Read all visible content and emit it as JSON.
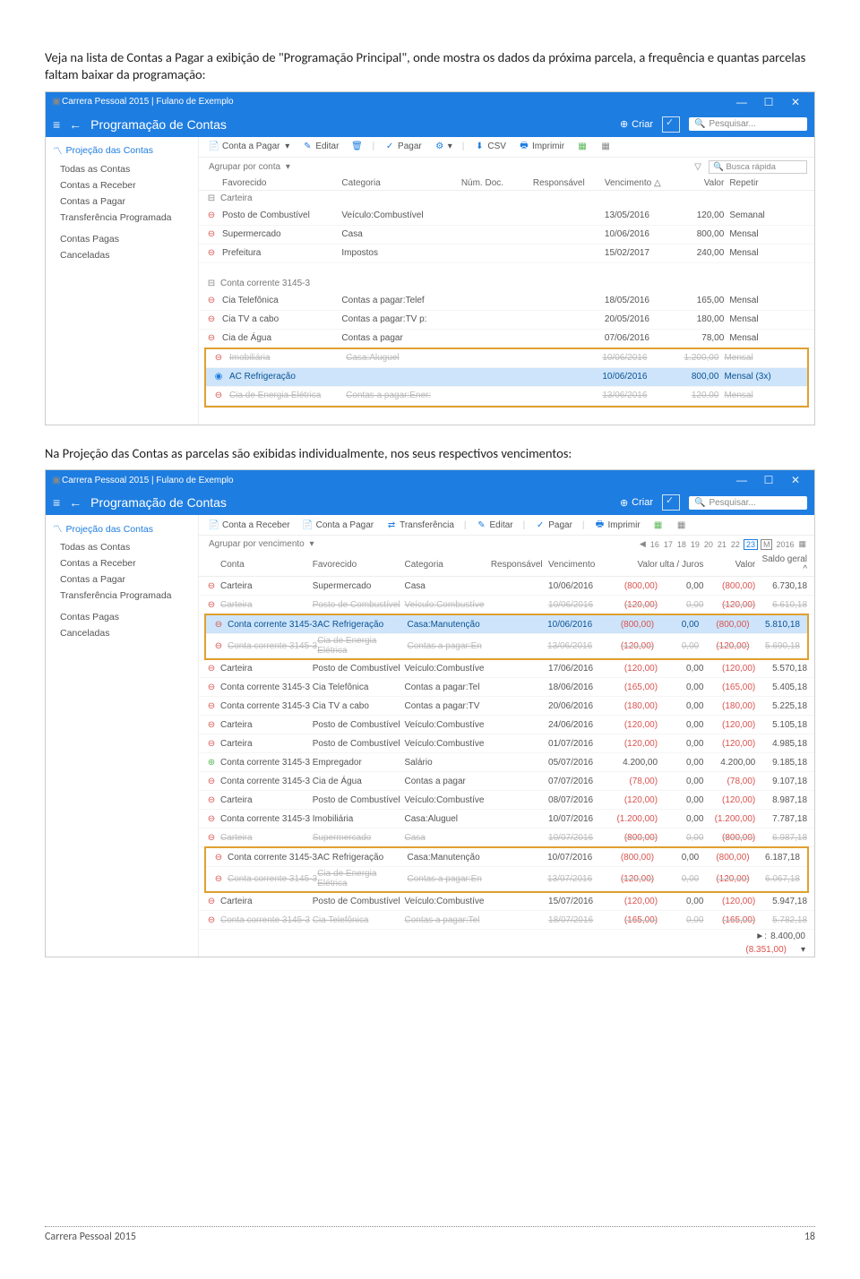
{
  "doc": {
    "p1": "Veja na lista de Contas a Pagar a exibição de \"Programação Principal\", onde mostra os dados da próxima parcela, a frequência e quantas parcelas faltam baixar da programação:",
    "p2": "Na Projeção das Contas as parcelas são exibidas individualmente, nos seus respectivos vencimentos:",
    "footer_left": "Carrera Pessoal 2015",
    "footer_right": "18"
  },
  "s1": {
    "title": "Carrera Pessoal 2015 | Fulano de Exemplo",
    "section": "Programação de Contas",
    "criar": "Criar",
    "search_ph": "Pesquisar...",
    "sidebar_header": "Projeção das Contas",
    "sidebar": [
      "Todas as Contas",
      "Contas a Receber",
      "Contas a Pagar",
      "Transferência Programada",
      "Contas Pagas",
      "Canceladas"
    ],
    "actions": [
      "Conta a Pagar",
      "Editar",
      "Pagar",
      "CSV",
      "Imprimir"
    ],
    "group_label": "Agrupar por conta",
    "quick_ph": "Busca rápida",
    "cols": [
      "Favorecido",
      "Categoria",
      "Núm. Doc.",
      "Responsável",
      "Vencimento",
      "Valor",
      "Repetir"
    ],
    "g1": "Carteira",
    "g1rows": [
      {
        "fav": "Posto de Combustível",
        "cat": "Veículo:Combustível",
        "venc": "13/05/2016",
        "valor": "120,00",
        "rep": "Semanal"
      },
      {
        "fav": "Supermercado",
        "cat": "Casa",
        "venc": "10/06/2016",
        "valor": "800,00",
        "rep": "Mensal"
      },
      {
        "fav": "Prefeitura",
        "cat": "Impostos",
        "venc": "15/02/2017",
        "valor": "240,00",
        "rep": "Mensal"
      }
    ],
    "g2": "Conta corrente 3145-3",
    "g2rows": [
      {
        "fav": "Cia Telefônica",
        "cat": "Contas a pagar:Telef",
        "venc": "18/05/2016",
        "valor": "165,00",
        "rep": "Mensal"
      },
      {
        "fav": "Cia TV a cabo",
        "cat": "Contas a pagar:TV p:",
        "venc": "20/05/2016",
        "valor": "180,00",
        "rep": "Mensal"
      },
      {
        "fav": "Cia de Água",
        "cat": "Contas a pagar",
        "venc": "07/06/2016",
        "valor": "78,00",
        "rep": "Mensal"
      }
    ],
    "g2box": [
      {
        "fav": "Imobiliária",
        "cat": "Casa:Aluguel",
        "venc": "10/06/2016",
        "valor": "1.200,00",
        "rep": "Mensal",
        "strike": true
      },
      {
        "fav": "AC Refrigeração",
        "cat": "",
        "venc": "10/06/2016",
        "valor": "800,00",
        "rep": "Mensal (3x)",
        "sel": true
      },
      {
        "fav": "Cia de Energia Elétrica",
        "cat": "Contas a pagar:Ener:",
        "venc": "13/06/2016",
        "valor": "120,00",
        "rep": "Mensal",
        "strike": true
      }
    ]
  },
  "s2": {
    "title": "Carrera Pessoal 2015 | Fulano de Exemplo",
    "section": "Programação de Contas",
    "criar": "Criar",
    "search_ph": "Pesquisar...",
    "sidebar_header": "Projeção das Contas",
    "sidebar": [
      "Todas as Contas",
      "Contas a Receber",
      "Contas a Pagar",
      "Transferência Programada",
      "Contas Pagas",
      "Canceladas"
    ],
    "actions": [
      "Conta a Receber",
      "Conta a Pagar",
      "Transferência",
      "Editar",
      "Pagar",
      "Imprimir"
    ],
    "group_label": "Agrupar por vencimento",
    "months": [
      "16",
      "17",
      "18",
      "19",
      "20",
      "21",
      "22"
    ],
    "month_cur": "23",
    "month_m": "M",
    "year": "2016",
    "cols": [
      "Conta",
      "Favorecido",
      "Categoria",
      "Responsável",
      "Vencimento",
      "Valor",
      "ulta / Juros",
      "Valor",
      "Saldo geral"
    ],
    "rows": [
      {
        "ic": "-",
        "conta": "Carteira",
        "fav": "Supermercado",
        "cat": "Casa",
        "venc": "10/06/2016",
        "v": "(800,00)",
        "j": "0,00",
        "v2": "(800,00)",
        "s": "6.730,18"
      },
      {
        "ic": "-",
        "conta": "Carteira",
        "fav": "Posto de Combustível",
        "cat": "Veículo:Combustíve",
        "venc": "10/06/2016",
        "v": "(120,00)",
        "j": "0,00",
        "v2": "(120,00)",
        "s": "6.610,18",
        "strike": true
      }
    ],
    "box1": [
      {
        "ic": "-",
        "conta": "Conta corrente 3145-3",
        "fav": "AC Refrigeração",
        "cat": "Casa:Manutenção",
        "venc": "10/06/2016",
        "v": "(800,00)",
        "j": "0,00",
        "v2": "(800,00)",
        "s": "5.810,18",
        "sel": true
      },
      {
        "ic": "-",
        "conta": "Conta corrente 3145-3",
        "fav": "Cia de Energia Elétrica",
        "cat": "Contas a pagar:En",
        "venc": "13/06/2016",
        "v": "(120,00)",
        "j": "0,00",
        "v2": "(120,00)",
        "s": "5.690,18",
        "strike": true
      }
    ],
    "rows2": [
      {
        "ic": "-",
        "conta": "Carteira",
        "fav": "Posto de Combustível",
        "cat": "Veículo:Combustíve",
        "venc": "17/06/2016",
        "v": "(120,00)",
        "j": "0,00",
        "v2": "(120,00)",
        "s": "5.570,18"
      },
      {
        "ic": "-",
        "conta": "Conta corrente 3145-3",
        "fav": "Cia Telefônica",
        "cat": "Contas a pagar:Tel",
        "venc": "18/06/2016",
        "v": "(165,00)",
        "j": "0,00",
        "v2": "(165,00)",
        "s": "5.405,18"
      },
      {
        "ic": "-",
        "conta": "Conta corrente 3145-3",
        "fav": "Cia TV a cabo",
        "cat": "Contas a pagar:TV",
        "venc": "20/06/2016",
        "v": "(180,00)",
        "j": "0,00",
        "v2": "(180,00)",
        "s": "5.225,18"
      },
      {
        "ic": "-",
        "conta": "Carteira",
        "fav": "Posto de Combustível",
        "cat": "Veículo:Combustíve",
        "venc": "24/06/2016",
        "v": "(120,00)",
        "j": "0,00",
        "v2": "(120,00)",
        "s": "5.105,18"
      },
      {
        "ic": "-",
        "conta": "Carteira",
        "fav": "Posto de Combustível",
        "cat": "Veículo:Combustíve",
        "venc": "01/07/2016",
        "v": "(120,00)",
        "j": "0,00",
        "v2": "(120,00)",
        "s": "4.985,18"
      },
      {
        "ic": "+",
        "conta": "Conta corrente 3145-3",
        "fav": "Empregador",
        "cat": "Salário",
        "venc": "05/07/2016",
        "v": "4.200,00",
        "j": "0,00",
        "v2": "4.200,00",
        "s": "9.185,18"
      },
      {
        "ic": "-",
        "conta": "Conta corrente 3145-3",
        "fav": "Cia de Água",
        "cat": "Contas a pagar",
        "venc": "07/07/2016",
        "v": "(78,00)",
        "j": "0,00",
        "v2": "(78,00)",
        "s": "9.107,18"
      },
      {
        "ic": "-",
        "conta": "Carteira",
        "fav": "Posto de Combustível",
        "cat": "Veículo:Combustíve",
        "venc": "08/07/2016",
        "v": "(120,00)",
        "j": "0,00",
        "v2": "(120,00)",
        "s": "8.987,18"
      },
      {
        "ic": "-",
        "conta": "Conta corrente 3145-3",
        "fav": "Imobiliária",
        "cat": "Casa:Aluguel",
        "venc": "10/07/2016",
        "v": "(1.200,00)",
        "j": "0,00",
        "v2": "(1.200,00)",
        "s": "7.787,18"
      },
      {
        "ic": "-",
        "conta": "Carteira",
        "fav": "Supermercado",
        "cat": "Casa",
        "venc": "10/07/2016",
        "v": "(800,00)",
        "j": "0,00",
        "v2": "(800,00)",
        "s": "6.987,18",
        "strike": true
      }
    ],
    "box2": [
      {
        "ic": "-",
        "conta": "Conta corrente 3145-3",
        "fav": "AC Refrigeração",
        "cat": "Casa:Manutenção",
        "venc": "10/07/2016",
        "v": "(800,00)",
        "j": "0,00",
        "v2": "(800,00)",
        "s": "6.187,18"
      },
      {
        "ic": "-",
        "conta": "Conta corrente 3145-3",
        "fav": "Cia de Energia Elétrica",
        "cat": "Contas a pagar:En",
        "venc": "13/07/2016",
        "v": "(120,00)",
        "j": "0,00",
        "v2": "(120,00)",
        "s": "6.067,18",
        "strike": true
      }
    ],
    "rows3": [
      {
        "ic": "-",
        "conta": "Carteira",
        "fav": "Posto de Combustível",
        "cat": "Veículo:Combustíve",
        "venc": "15/07/2016",
        "v": "(120,00)",
        "j": "0,00",
        "v2": "(120,00)",
        "s": "5.947,18"
      },
      {
        "ic": "-",
        "conta": "Conta corrente 3145-3",
        "fav": "Cia Telefônica",
        "cat": "Contas a pagar:Tel",
        "venc": "18/07/2016",
        "v": "(165,00)",
        "j": "0,00",
        "v2": "(165,00)",
        "s": "5.782,18",
        "strike": true
      }
    ],
    "tot1_lbl": "►:",
    "tot1": "8.400,00",
    "tot2": "(8.351,00)"
  }
}
